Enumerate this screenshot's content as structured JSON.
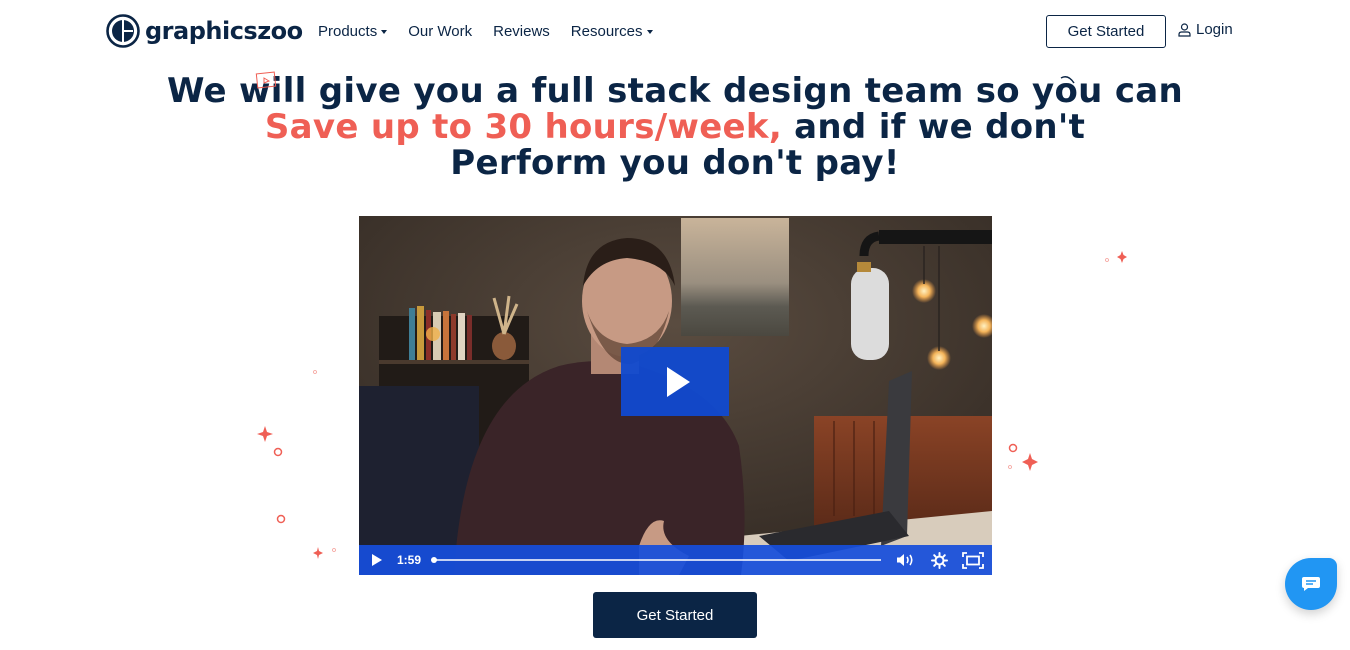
{
  "brand": {
    "name": "graphicszoo",
    "primary_color": "#0b2545",
    "accent_color": "#ef5f55",
    "video_blue": "#164edc",
    "chat_blue": "#2196f3"
  },
  "nav": {
    "items": [
      {
        "label": "Products",
        "has_dropdown": true
      },
      {
        "label": "Our Work",
        "has_dropdown": false
      },
      {
        "label": "Reviews",
        "has_dropdown": false
      },
      {
        "label": "Resources",
        "has_dropdown": true
      }
    ],
    "get_started_label": "Get Started",
    "login_label": "Login"
  },
  "hero": {
    "line1": "We will give you a full stack design team so you can",
    "line2_accent": "Save up to 30 hours/week,",
    "line2_rest": " and if we don't",
    "line3": "Perform you don't pay!"
  },
  "video": {
    "current_time": "1:59",
    "progress": 0.0,
    "icons": [
      "play-icon",
      "volume-icon",
      "settings-icon",
      "fullscreen-icon"
    ]
  },
  "cta": {
    "label": "Get Started"
  },
  "chat_widget": {
    "icon": "chat-bubble-icon"
  }
}
